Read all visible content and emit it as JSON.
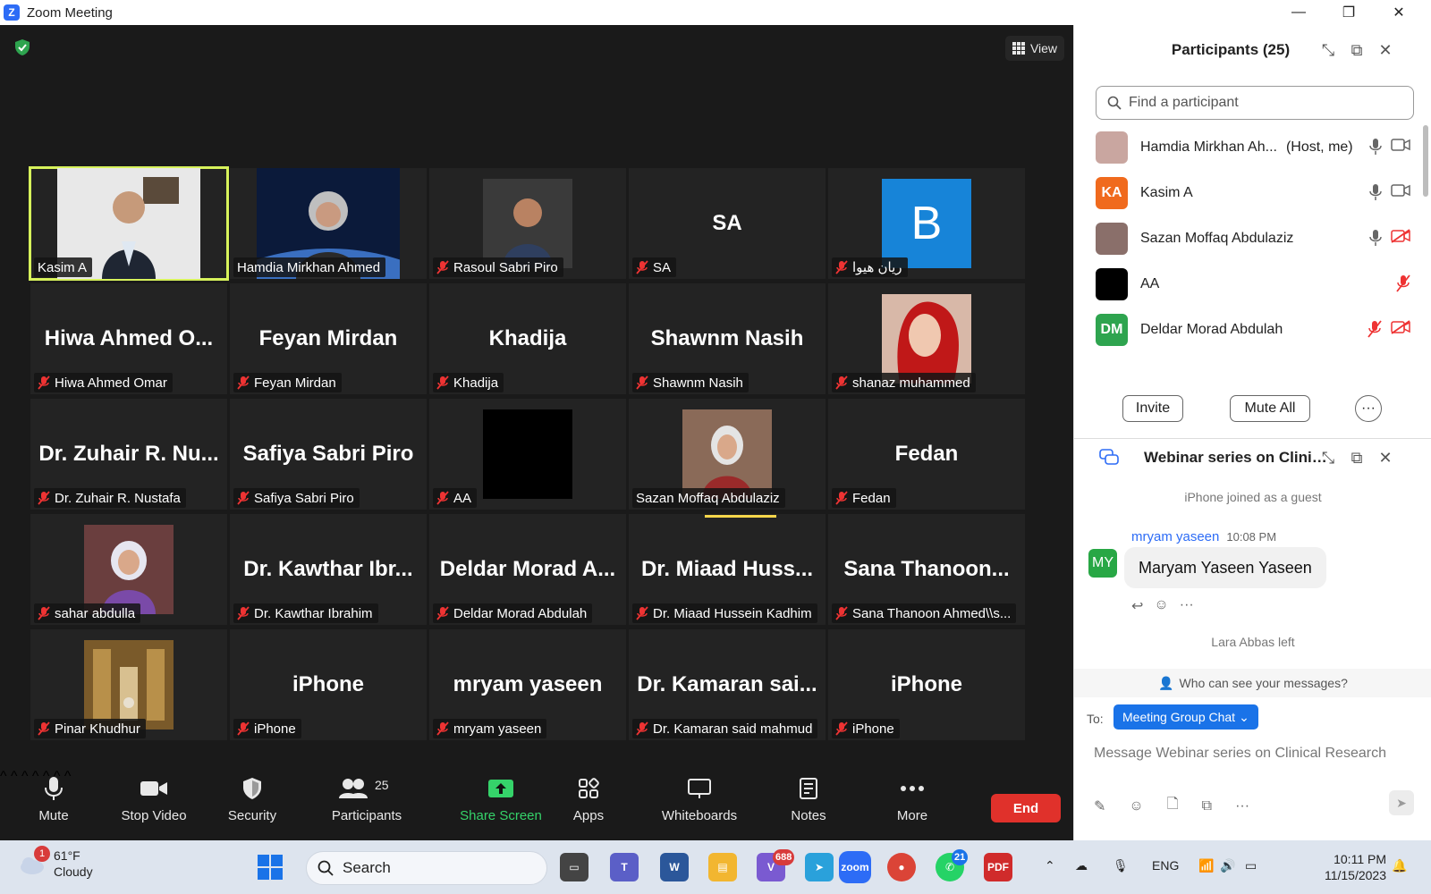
{
  "window": {
    "title": "Zoom Meeting",
    "minimize": "—",
    "restore": "❐",
    "close": "✕"
  },
  "meeting": {
    "view_label": "View",
    "tiles": [
      {
        "big": "",
        "label": "Kasim A",
        "muted": false,
        "photo": "person-suit",
        "active": true
      },
      {
        "big": "",
        "label": "Hamdia Mirkhan Ahmed",
        "muted": false,
        "photo": "woman-earth",
        "active": false
      },
      {
        "big": "",
        "label": "Rasoul Sabri Piro",
        "muted": true,
        "photo": "man",
        "active": false
      },
      {
        "big": "SA",
        "label": "SA",
        "muted": true,
        "photo": "",
        "active": false
      },
      {
        "big": "",
        "label": "ريان هيوا",
        "muted": true,
        "photo": "b-blue",
        "active": false
      },
      {
        "big": "Hiwa Ahmed O...",
        "label": "Hiwa Ahmed Omar",
        "muted": true,
        "photo": "",
        "active": false
      },
      {
        "big": "Feyan Mirdan",
        "label": "Feyan Mirdan",
        "muted": true,
        "photo": "",
        "active": false
      },
      {
        "big": "Khadija",
        "label": "Khadija",
        "muted": true,
        "photo": "",
        "active": false
      },
      {
        "big": "Shawnm Nasih",
        "label": "Shawnm Nasih",
        "muted": true,
        "photo": "",
        "active": false
      },
      {
        "big": "",
        "label": "shanaz muhammed",
        "muted": true,
        "photo": "woman-red",
        "active": false
      },
      {
        "big": "Dr. Zuhair R. Nu...",
        "label": "Dr. Zuhair R. Nustafa",
        "muted": true,
        "photo": "",
        "active": false
      },
      {
        "big": "Safiya Sabri Piro",
        "label": "Safiya Sabri Piro",
        "muted": true,
        "photo": "",
        "active": false
      },
      {
        "big": "",
        "label": "AA",
        "muted": true,
        "photo": "black",
        "active": false
      },
      {
        "big": "",
        "label": "Sazan Moffaq Abdulaziz",
        "muted": false,
        "photo": "woman-hijab",
        "active": false
      },
      {
        "big": "Fedan",
        "label": "Fedan",
        "muted": true,
        "photo": "",
        "active": false
      },
      {
        "big": "",
        "label": "sahar abdulla",
        "muted": true,
        "photo": "woman-purple",
        "active": false
      },
      {
        "big": "Dr. Kawthar Ibr...",
        "label": "Dr. Kawthar Ibrahim",
        "muted": true,
        "photo": "",
        "active": false
      },
      {
        "big": "Deldar Morad A...",
        "label": "Deldar Morad Abdulah",
        "muted": true,
        "photo": "",
        "active": false
      },
      {
        "big": "Dr. Miaad Huss...",
        "label": "Dr. Miaad Hussein Kadhim",
        "muted": true,
        "photo": "",
        "active": false
      },
      {
        "big": "Sana Thanoon...",
        "label": "Sana Thanoon Ahmed\\\\s...",
        "muted": true,
        "photo": "",
        "active": false
      },
      {
        "big": "",
        "label": "Pinar Khudhur",
        "muted": true,
        "photo": "hall",
        "active": false
      },
      {
        "big": "iPhone",
        "label": "iPhone",
        "muted": true,
        "photo": "",
        "active": false
      },
      {
        "big": "mryam yaseen",
        "label": "mryam yaseen",
        "muted": true,
        "photo": "",
        "active": false
      },
      {
        "big": "Dr. Kamaran sai...",
        "label": "Dr. Kamaran said mahmud",
        "muted": true,
        "photo": "",
        "active": false
      },
      {
        "big": "iPhone",
        "label": "iPhone",
        "muted": true,
        "photo": "",
        "active": false
      }
    ]
  },
  "toolbar": {
    "mute": "Mute",
    "stop_video": "Stop Video",
    "security": "Security",
    "participants": "Participants",
    "participants_count": "25",
    "share_screen": "Share Screen",
    "apps": "Apps",
    "whiteboards": "Whiteboards",
    "notes": "Notes",
    "more": "More",
    "end": "End"
  },
  "participants_panel": {
    "title": "Participants (25)",
    "search_placeholder": "Find a participant",
    "rows": [
      {
        "initials": "",
        "name": "Hamdia Mirkhan Ah...",
        "role": "(Host, me)",
        "color": "#c9a6a0"
      },
      {
        "initials": "KA",
        "name": "Kasim A",
        "role": "",
        "color": "#f06a1d"
      },
      {
        "initials": "",
        "name": "Sazan Moffaq Abdulaziz",
        "role": "",
        "color": "#8a6f6a"
      },
      {
        "initials": "",
        "name": "AA",
        "role": "",
        "color": "#000000"
      },
      {
        "initials": "DM",
        "name": "Deldar Morad Abdulah",
        "role": "",
        "color": "#2ea44f"
      }
    ],
    "invite": "Invite",
    "mute_all": "Mute All",
    "more": "···"
  },
  "chat": {
    "title": "Webinar series on Clinic...",
    "system_joined": "iPhone joined as a guest",
    "sender": "mryam yaseen",
    "time": "10:08 PM",
    "sender_initials": "MY",
    "message": "Maryam Yaseen Yaseen",
    "system_left": "Lara Abbas left",
    "who_can_see": "Who can see your messages?",
    "to_label": "To:",
    "to_target": "Meeting Group Chat",
    "input_placeholder": "Message Webinar series on Clinical Research"
  },
  "taskbar": {
    "temp": "61°F",
    "condition": "Cloudy",
    "weather_badge": "1",
    "search": "Search",
    "viber_badge": "688",
    "whatsapp_badge": "21",
    "lang": "ENG",
    "time": "10:11 PM",
    "date": "11/15/2023"
  },
  "colors": {
    "accent": "#2d6cf6",
    "end": "#e0312b",
    "active_speaker": "#d7f25b",
    "share": "#35d36a"
  }
}
